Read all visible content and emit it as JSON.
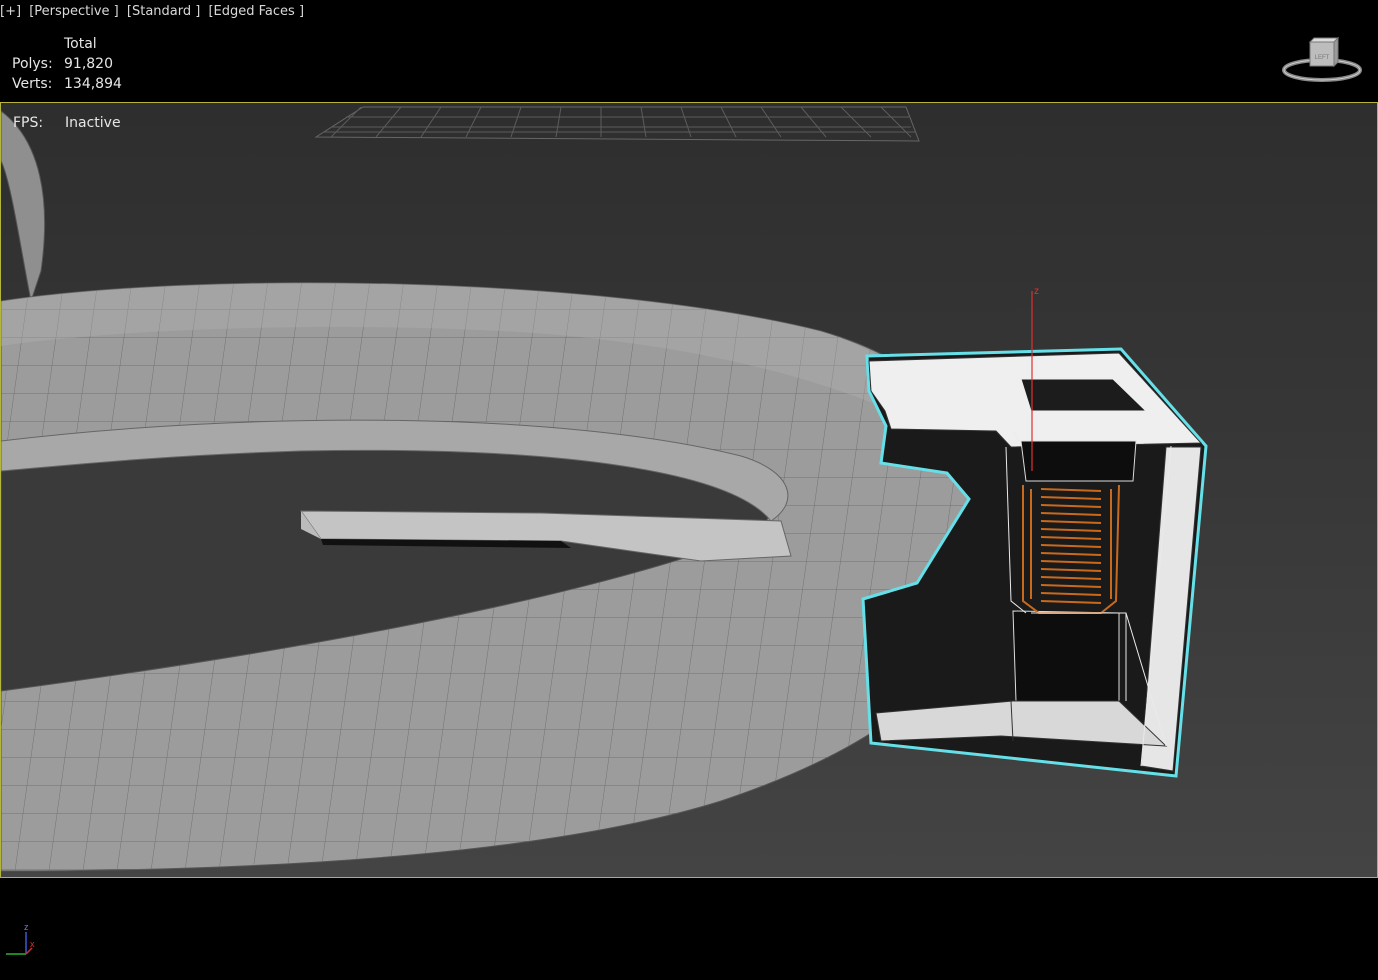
{
  "viewport_labels": [
    "[+]",
    "[Perspective ]",
    "[Standard ]",
    "[Edged Faces ]"
  ],
  "stats": {
    "header": "Total",
    "polys_label": "Polys:",
    "polys_value": "91,820",
    "verts_label": "Verts:",
    "verts_value": "134,894"
  },
  "fps": {
    "label": "FPS:",
    "value": "Inactive"
  },
  "viewcube": {
    "face_label": "LEFT"
  },
  "axis_tripod": {
    "z": "z",
    "x": "x"
  },
  "colors": {
    "viewport_border": "#b5b53d",
    "selection_outline": "#66e0e8",
    "coil": "#c86a1e",
    "gizmo_z": "#e03030",
    "mesh_fill": "#9a9a9a"
  }
}
